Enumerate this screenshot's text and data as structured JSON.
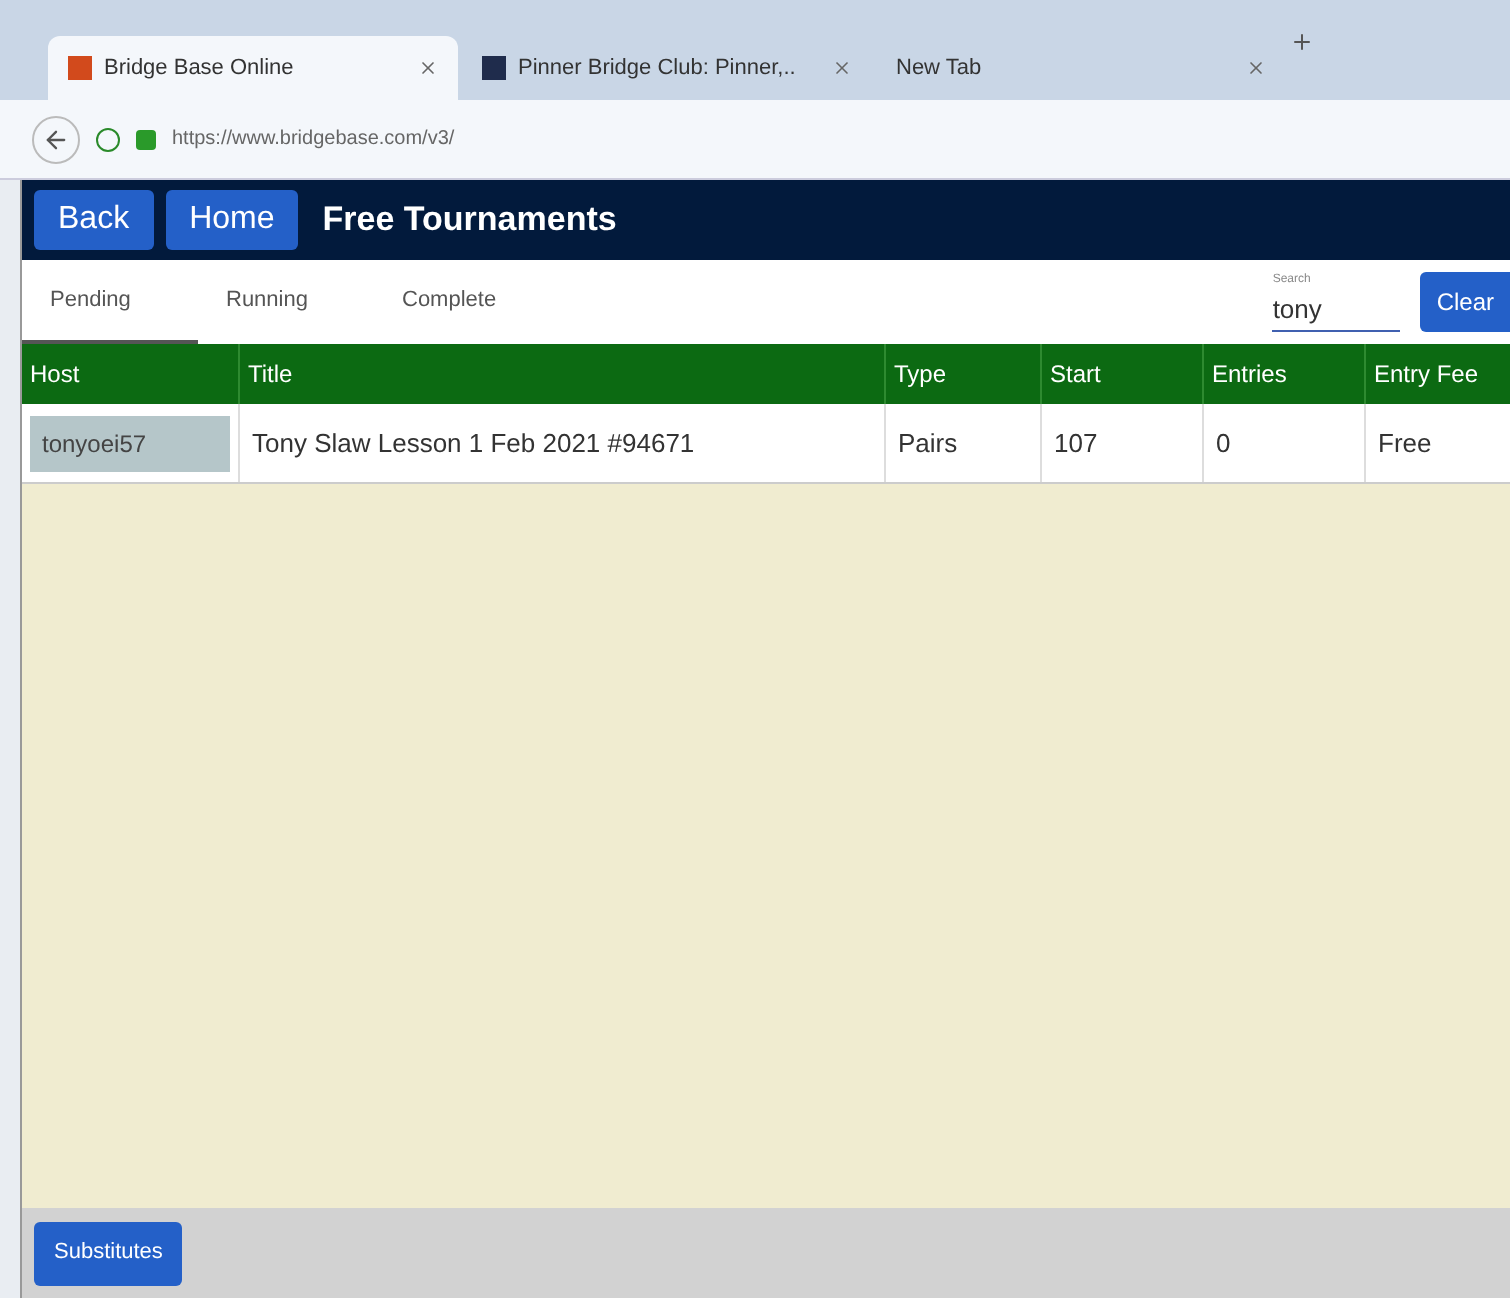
{
  "browser": {
    "tabs": [
      {
        "label": "Bridge Base Online",
        "selected": true
      },
      {
        "label": "Pinner Bridge Club: Pinner,..",
        "selected": false
      },
      {
        "label": "New Tab",
        "selected": false
      }
    ],
    "url": "https://www.bridgebase.com/v3/"
  },
  "header": {
    "buttons": [
      "Back",
      "Home"
    ],
    "title": "Free Tournaments"
  },
  "tabs": [
    {
      "label": "Pending",
      "selected": true
    },
    {
      "label": "Running",
      "selected": false
    },
    {
      "label": "Complete",
      "selected": false
    }
  ],
  "search": {
    "label": "Search",
    "value": "tony"
  },
  "clear_button": "Clear",
  "table": {
    "columns": [
      "Host",
      "Title",
      "Type",
      "Start",
      "Entries",
      "Entry Fee"
    ],
    "rows": [
      [
        "tonyoei57",
        "Tony Slaw Lesson 1 Feb 2021 #94671",
        "Pairs",
        "107",
        "0",
        "Free"
      ]
    ]
  },
  "footer": {
    "button": "Substitutes"
  }
}
